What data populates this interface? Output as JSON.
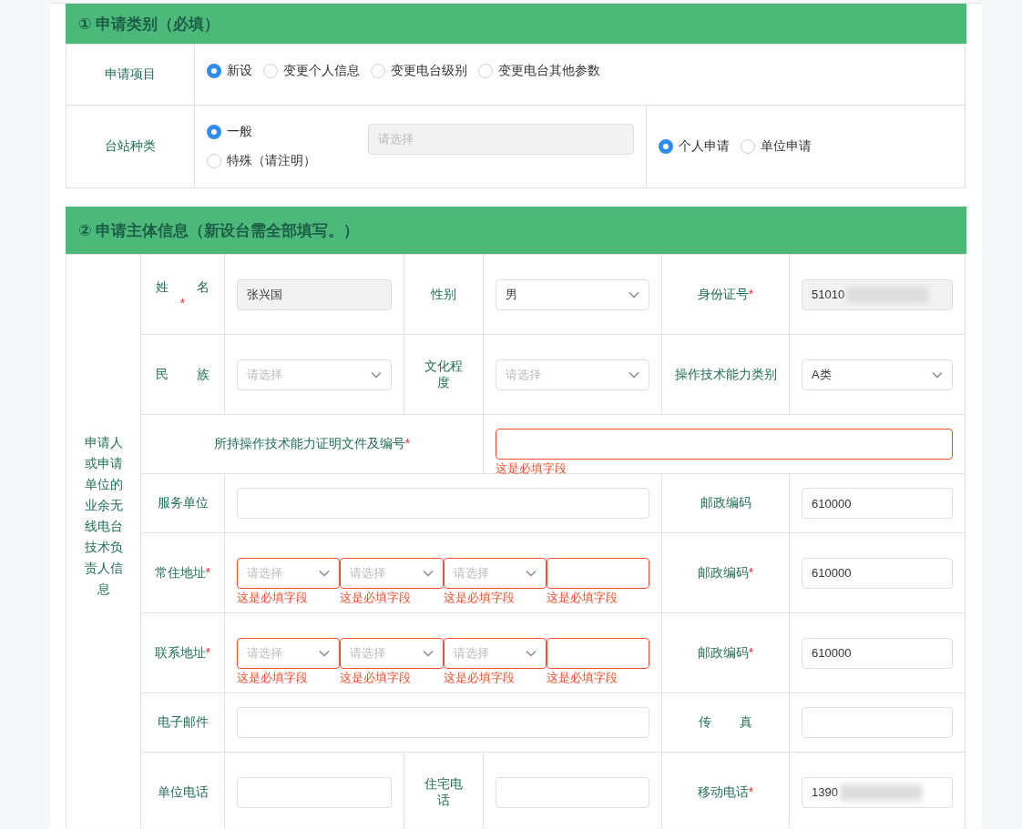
{
  "section1": {
    "title": "① 申请类别（必填）",
    "apply_item": {
      "label": "申请项目",
      "options": [
        {
          "label": "新设",
          "selected": true
        },
        {
          "label": "变更个人信息",
          "selected": false
        },
        {
          "label": "变更电台级别",
          "selected": false
        },
        {
          "label": "变更电台其他参数",
          "selected": false
        }
      ]
    },
    "station_type": {
      "label": "台站种类",
      "options": [
        {
          "label": "一般",
          "selected": true
        },
        {
          "label": "特殊（请注明）",
          "selected": false
        }
      ],
      "remark": {
        "placeholder": "请选择",
        "disabled": true
      },
      "applicant_options": [
        {
          "label": "个人申请",
          "selected": true
        },
        {
          "label": "单位申请",
          "selected": false
        }
      ]
    }
  },
  "section2": {
    "title": "② 申请主体信息（新设台需全部填写。）",
    "side_label": "申请人或申请单位的业余无线电台技术负责人信息",
    "rows": [
      {
        "kind": "triple",
        "cells": [
          {
            "label": {
              "text": "姓 名",
              "required_mark": "*"
            },
            "field": {
              "kind": "text",
              "value": "张兴国",
              "disabled": true
            }
          },
          {
            "label": {
              "text": "性别"
            },
            "field": {
              "kind": "select",
              "value": "男"
            }
          },
          {
            "label": {
              "text": "身份证号",
              "required_mark": "*"
            },
            "field": {
              "kind": "text",
              "value": "51010",
              "disabled": true,
              "redacted": true
            }
          }
        ]
      },
      {
        "kind": "triple",
        "cells": [
          {
            "label": {
              "text": "民 族"
            },
            "field": {
              "kind": "select",
              "placeholder": "请选择"
            }
          },
          {
            "label": {
              "text": "文化程度"
            },
            "field": {
              "kind": "select",
              "placeholder": "请选择"
            }
          },
          {
            "label": {
              "text": "操作技术能力类别"
            },
            "field": {
              "kind": "select",
              "value": "A类"
            }
          }
        ]
      },
      {
        "kind": "full",
        "cells": [
          {
            "label": {
              "text": "所持操作技术能力证明文件及编号",
              "required_mark": "*"
            },
            "field": {
              "kind": "text",
              "error": "这是必填字段"
            }
          }
        ]
      },
      {
        "kind": "pair",
        "cells": [
          {
            "label": {
              "text": "服务单位"
            },
            "field": {
              "kind": "text"
            }
          },
          {
            "label": {
              "text": "邮政编码"
            },
            "field": {
              "kind": "text",
              "value": "610000"
            }
          }
        ]
      },
      {
        "kind": "pair",
        "cells": [
          {
            "label": {
              "text": "常住地址",
              "required_mark": "*"
            },
            "field": {
              "kind": "address",
              "parts": [
                {
                  "kind": "select",
                  "placeholder": "请选择",
                  "error": "这是必填字段"
                },
                {
                  "kind": "select",
                  "placeholder": "请选择",
                  "error": "这是必填字段"
                },
                {
                  "kind": "select",
                  "placeholder": "请选择",
                  "error": "这是必填字段"
                },
                {
                  "kind": "text",
                  "error": "这是必填字段"
                }
              ]
            }
          },
          {
            "label": {
              "text": "邮政编码",
              "required_mark": "*"
            },
            "field": {
              "kind": "text",
              "value": "610000"
            }
          }
        ]
      },
      {
        "kind": "pair",
        "cells": [
          {
            "label": {
              "text": "联系地址",
              "required_mark": "*"
            },
            "field": {
              "kind": "address",
              "parts": [
                {
                  "kind": "select",
                  "placeholder": "请选择",
                  "error": "这是必填字段"
                },
                {
                  "kind": "select",
                  "placeholder": "请选择",
                  "error": "这是必填字段"
                },
                {
                  "kind": "select",
                  "placeholder": "请选择",
                  "error": "这是必填字段"
                },
                {
                  "kind": "text",
                  "error": "这是必填字段"
                }
              ]
            }
          },
          {
            "label": {
              "text": "邮政编码",
              "required_mark": "*"
            },
            "field": {
              "kind": "text",
              "value": "610000"
            }
          }
        ]
      },
      {
        "kind": "pair",
        "cells": [
          {
            "label": {
              "text": "电子邮件"
            },
            "field": {
              "kind": "text"
            }
          },
          {
            "label": {
              "text": "传 真"
            },
            "field": {
              "kind": "text"
            }
          }
        ]
      },
      {
        "kind": "triple",
        "cells": [
          {
            "label": {
              "text": "单位电话"
            },
            "field": {
              "kind": "text"
            }
          },
          {
            "label": {
              "text": "住宅电话"
            },
            "field": {
              "kind": "text"
            }
          },
          {
            "label": {
              "text": "移动电话",
              "required_mark": "*"
            },
            "field": {
              "kind": "text",
              "value": "1390",
              "redacted": true
            }
          }
        ]
      }
    ]
  }
}
